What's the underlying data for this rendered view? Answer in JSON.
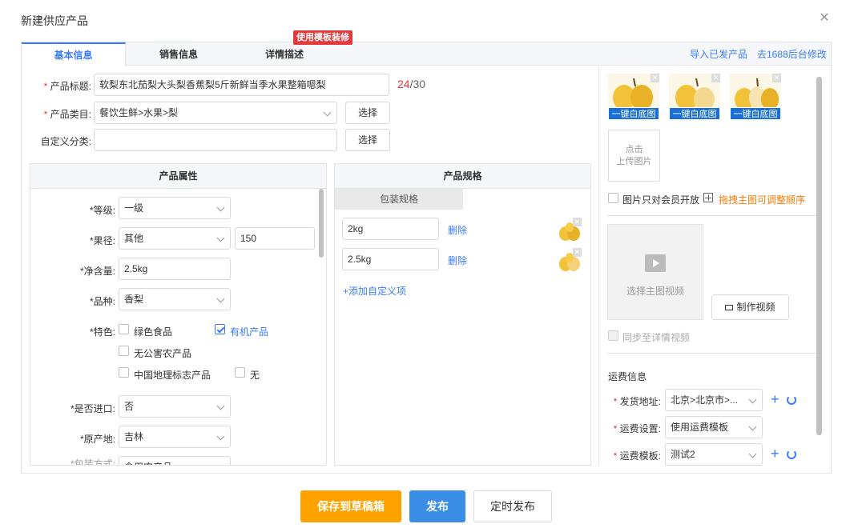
{
  "dialog": {
    "title": "新建供应产品"
  },
  "tabs": [
    {
      "label": "基本信息"
    },
    {
      "label": "销售信息"
    },
    {
      "label": "详情描述"
    }
  ],
  "template_badge": "使用模板装修",
  "top_links": {
    "import": "导入已发产品",
    "goto1688": "去1688后台修改"
  },
  "basic": {
    "title_label": "产品标题:",
    "title_value": "软梨东北茄梨大头梨香蕉梨5斤新鲜当季水果整箱嗯梨",
    "title_count": "24",
    "title_max": "/30",
    "category_label": "产品类目:",
    "category_value": "餐饮生鲜>水果>梨",
    "custom_label": "自定义分类:",
    "select_label": "选择",
    "required_mark": "*"
  },
  "attributes": {
    "header": "产品属性",
    "grade_label": "*等级:",
    "grade_value": "一级",
    "diameter_label": "*果径:",
    "diameter_value": "其他",
    "diameter_extra": "150",
    "net_label": "*净含量:",
    "net_value": "2.5kg",
    "variety_label": "*品种:",
    "variety_value": "香梨",
    "feature_label": "*特色:",
    "features": [
      {
        "label": "绿色食品",
        "checked": false
      },
      {
        "label": "有机产品",
        "checked": true
      },
      {
        "label": "无公害农产品",
        "checked": false
      },
      {
        "label": "中国地理标志产品",
        "checked": false
      },
      {
        "label": "无",
        "checked": false
      }
    ],
    "import_label": "*是否进口:",
    "import_value": "否",
    "origin_label": "*原产地:",
    "origin_value": "吉林",
    "cut_label": "*包装方式:",
    "cut_value": "食用农产品"
  },
  "specs": {
    "header": "产品规格",
    "column": "包装规格",
    "items": [
      {
        "value": "2kg",
        "delete": "删除"
      },
      {
        "value": "2.5kg",
        "delete": "删除"
      }
    ],
    "add_custom": "+添加自定义项"
  },
  "images": {
    "white_bg_label": "一键白底图",
    "upload_label_1": "点击",
    "upload_label_2": "上传图片",
    "members_only": "图片只对会员开放",
    "drag_hint": "拖拽主图可调整顺序",
    "video_select": "选择主图视频",
    "make_video": "制作视频",
    "sync_video": "同步至详情视频"
  },
  "shipping": {
    "header": "运费信息",
    "address_label": "发货地址:",
    "address_value": "北京>北京市>...",
    "setting_label": "运费设置:",
    "setting_value": "使用运费模板",
    "template_label": "运费模板:",
    "template_value": "测试2"
  },
  "footer": {
    "save_draft": "保存到草稿箱",
    "publish": "发布",
    "schedule": "定时发布"
  },
  "colors": {
    "accent": "#3a7cff",
    "primary_btn": "#3a8ee6",
    "warning_btn": "#ffa200",
    "danger": "#e4393c",
    "hint_orange": "#ff7a00"
  }
}
